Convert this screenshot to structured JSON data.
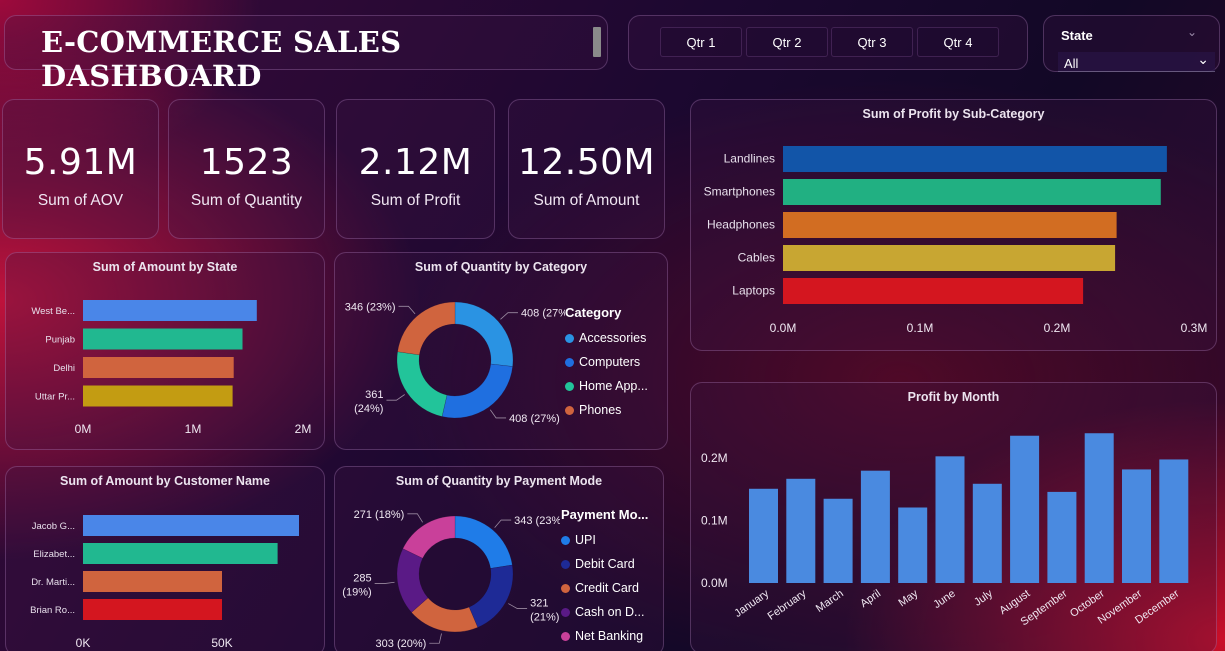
{
  "header": {
    "title": "E-COMMERCE SALES DASHBOARD",
    "quarters": [
      "Qtr 1",
      "Qtr 2",
      "Qtr 3",
      "Qtr 4"
    ],
    "state_filter": {
      "label": "State",
      "value": "All"
    }
  },
  "kpis": [
    {
      "value": "5.91M",
      "label": "Sum of AOV"
    },
    {
      "value": "1523",
      "label": "Sum of Quantity"
    },
    {
      "value": "2.12M",
      "label": "Sum of Profit"
    },
    {
      "value": "12.50M",
      "label": "Sum of Amount"
    }
  ],
  "chart_data": [
    {
      "id": "amount_by_state",
      "type": "bar",
      "orientation": "horizontal",
      "title": "Sum of Amount by State",
      "categories": [
        "West Be...",
        "Punjab",
        "Delhi",
        "Uttar Pr..."
      ],
      "values": [
        1.58,
        1.45,
        1.37,
        1.36
      ],
      "value_unit": "M",
      "colors": [
        "#4a86e8",
        "#21b890",
        "#d0643e",
        "#c39c12"
      ],
      "xticks": [
        "0M",
        "1M",
        "2M"
      ],
      "xlim": [
        0,
        2
      ]
    },
    {
      "id": "quantity_by_category",
      "type": "pie",
      "donut": true,
      "title": "Sum of Quantity by Category",
      "legend_title": "Category",
      "labels": [
        "Accessories",
        "Computers",
        "Home App...",
        "Phones"
      ],
      "values": [
        408,
        408,
        361,
        346
      ],
      "data_labels": [
        "408 (27%)",
        "408 (27%)",
        "361 (24%)",
        "346 (23%)"
      ],
      "colors": [
        "#2a93e3",
        "#1f6fe0",
        "#22c49a",
        "#d0643e"
      ]
    },
    {
      "id": "amount_by_customer",
      "type": "bar",
      "orientation": "horizontal",
      "title": "Sum of Amount by Customer Name",
      "categories": [
        "Jacob G...",
        "Elizabet...",
        "Dr. Marti...",
        "Brian Ro..."
      ],
      "values": [
        78000,
        70000,
        50000,
        50000
      ],
      "colors": [
        "#4a86e8",
        "#21b890",
        "#d0643e",
        "#d4161f"
      ],
      "xticks": [
        "0K",
        "50K"
      ],
      "xlim": [
        0,
        50000
      ]
    },
    {
      "id": "quantity_by_payment",
      "type": "pie",
      "donut": true,
      "title": "Sum of Quantity by Payment Mode",
      "legend_title": "Payment Mo...",
      "labels": [
        "UPI",
        "Debit Card",
        "Credit Card",
        "Cash on D...",
        "Net Banking"
      ],
      "values": [
        343,
        321,
        303,
        285,
        271
      ],
      "data_labels": [
        "343 (23%)",
        "321 (21%)",
        "303 (20%)",
        "285 (19%)",
        "271 (18%)"
      ],
      "colors": [
        "#1f7ce8",
        "#1e2a96",
        "#d0643e",
        "#5a1a86",
        "#c9409a"
      ]
    },
    {
      "id": "profit_by_subcategory",
      "type": "bar",
      "orientation": "horizontal",
      "title": "Sum of Profit by Sub-Category",
      "categories": [
        "Landlines",
        "Smartphones",
        "Headphones",
        "Cables",
        "Laptops"
      ],
      "values": [
        0.252,
        0.248,
        0.219,
        0.218,
        0.197
      ],
      "value_unit": "M",
      "colors": [
        "#1255a8",
        "#21b082",
        "#d26d22",
        "#c8a632",
        "#d4161f"
      ],
      "xticks": [
        "0.0M",
        "0.1M",
        "0.2M",
        "0.3M"
      ],
      "xlim": [
        0,
        0.3
      ]
    },
    {
      "id": "profit_by_month",
      "type": "bar",
      "title": "Profit by Month",
      "categories": [
        "January",
        "February",
        "March",
        "April",
        "May",
        "June",
        "July",
        "August",
        "September",
        "October",
        "November",
        "December"
      ],
      "values": [
        0.151,
        0.167,
        0.135,
        0.18,
        0.121,
        0.203,
        0.159,
        0.236,
        0.146,
        0.24,
        0.182,
        0.198
      ],
      "value_unit": "M",
      "color": "#4a8ae0",
      "yticks": [
        "0.0M",
        "0.1M",
        "0.2M"
      ],
      "ylim": [
        0,
        0.25
      ]
    }
  ]
}
